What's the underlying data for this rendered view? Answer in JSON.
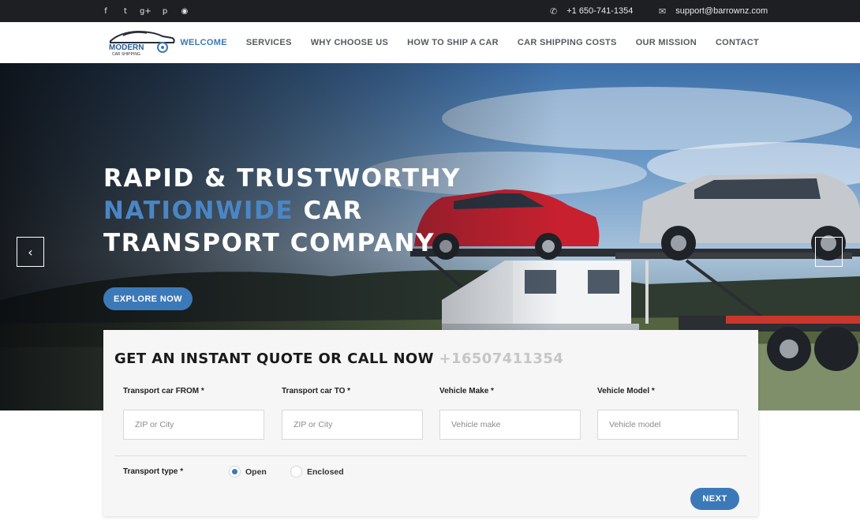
{
  "topbar": {
    "social_icons": [
      {
        "name": "facebook-icon",
        "glyph": "f"
      },
      {
        "name": "twitter-icon",
        "glyph": "t"
      },
      {
        "name": "google-plus-icon",
        "glyph": "g+"
      },
      {
        "name": "pinterest-icon",
        "glyph": "p"
      },
      {
        "name": "rss-icon",
        "glyph": "◉"
      }
    ],
    "phone": "+1 650-741-1354",
    "email": "support@barrownz.com"
  },
  "logo": {
    "line1": "MODERN",
    "line2": "CAR SHIPPING"
  },
  "nav": {
    "items": [
      {
        "label": "WELCOME",
        "active": true
      },
      {
        "label": "SERVICES",
        "active": false
      },
      {
        "label": "WHY CHOOSE US",
        "active": false
      },
      {
        "label": "HOW TO SHIP A CAR",
        "active": false
      },
      {
        "label": "CAR SHIPPING COSTS",
        "active": false
      },
      {
        "label": "OUR MISSION",
        "active": false
      },
      {
        "label": "CONTACT",
        "active": false
      }
    ]
  },
  "hero": {
    "line1": "RAPID & TRUSTWORTHY",
    "line2_blue": "NATIONWIDE",
    "line2_rest": " CAR",
    "line3": "TRANSPORT COMPANY",
    "cta": "EXPLORE NOW",
    "prev_glyph": "‹"
  },
  "quote": {
    "title": "GET AN INSTANT QUOTE OR CALL NOW ",
    "phone": "+16507411354",
    "fields": [
      {
        "label": "Transport car FROM *",
        "placeholder": "ZIP or City"
      },
      {
        "label": "Transport car TO *",
        "placeholder": "ZIP or City"
      },
      {
        "label": "Vehicle Make *",
        "placeholder": "Vehicle make"
      },
      {
        "label": "Vehicle Model *",
        "placeholder": "Vehicle model"
      }
    ],
    "transport_type_label": "Transport type *",
    "options": [
      {
        "label": "Open",
        "selected": true
      },
      {
        "label": "Enclosed",
        "selected": false
      }
    ],
    "next": "NEXT"
  },
  "colors": {
    "accent": "#3c79b9",
    "topbar": "#1d1f22",
    "nav_active": "#3a78b8"
  }
}
